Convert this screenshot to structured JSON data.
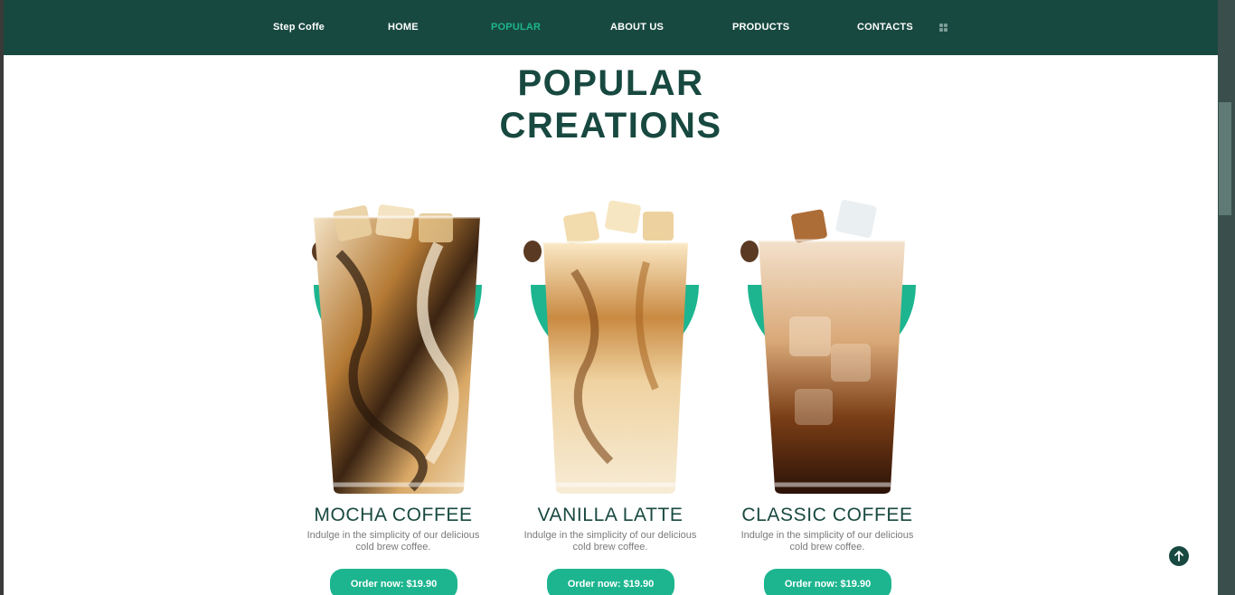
{
  "nav": {
    "brand": "Step Coffe",
    "items": [
      "HOME",
      "POPULAR",
      "ABOUT US",
      "PRODUCTS",
      "CONTACTS"
    ],
    "active": "POPULAR",
    "menu_icon": "grid-icon"
  },
  "section": {
    "title_line1": "POPULAR",
    "title_line2": "CREATIONS"
  },
  "products": [
    {
      "name": "MOCHA COFFEE",
      "description": "Indulge in the simplicity of our delicious cold brew coffee.",
      "button": "Order now: $19.90"
    },
    {
      "name": "VANILLA LATTE",
      "description": "Indulge in the simplicity of our delicious cold brew coffee.",
      "button": "Order now: $19.90"
    },
    {
      "name": "CLASSIC COFFEE",
      "description": "Indulge in the simplicity of our delicious cold brew coffee.",
      "button": "Order now: $19.90"
    }
  ],
  "colors": {
    "primary": "#184940",
    "accent": "#1db58f",
    "text_muted": "#7a7a7a"
  },
  "floating": {
    "back_to_top_icon": "arrow-up-icon"
  }
}
